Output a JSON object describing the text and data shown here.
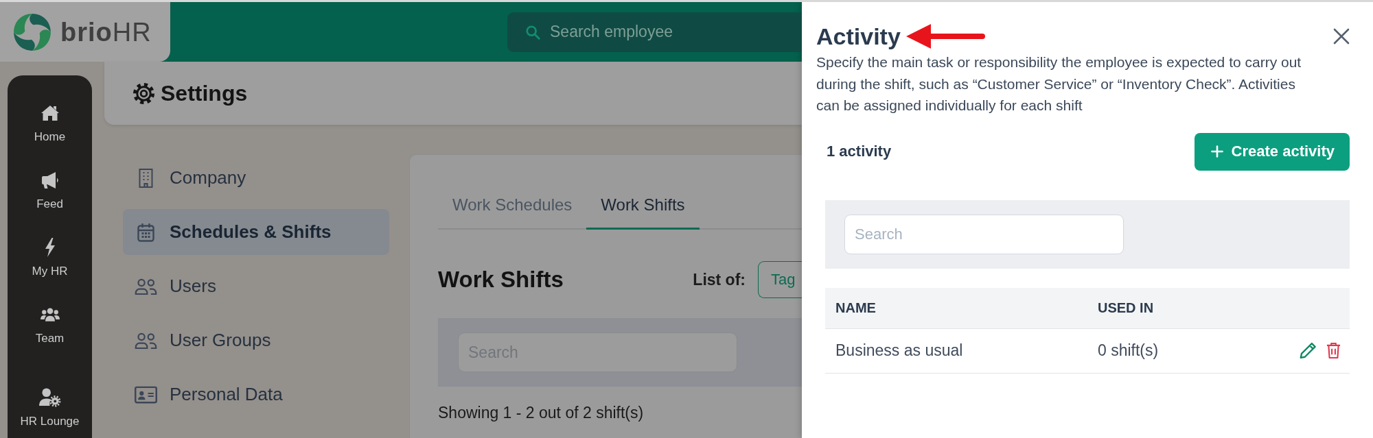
{
  "logo": {
    "text": "**brio**HR"
  },
  "header": {
    "search": {
      "placeholder": "Search employee"
    }
  },
  "sidebar": {
    "items": [
      {
        "label": "Home"
      },
      {
        "label": "Feed"
      },
      {
        "label": "My HR"
      },
      {
        "label": "Team"
      }
    ],
    "lower_items": [
      {
        "label": "HR Lounge"
      }
    ]
  },
  "page": {
    "title": "Settings"
  },
  "settings_nav": {
    "items": [
      {
        "label": "Company",
        "selected": false
      },
      {
        "label": "Schedules & Shifts",
        "selected": true
      },
      {
        "label": "Users",
        "selected": false
      },
      {
        "label": "User Groups",
        "selected": false
      },
      {
        "label": "Personal Data",
        "selected": false
      }
    ]
  },
  "content": {
    "tabs": [
      {
        "label": "Work Schedules",
        "selected": false
      },
      {
        "label": "Work Shifts",
        "selected": true
      }
    ],
    "title": "Work Shifts",
    "list_of": {
      "label": "List of:",
      "button": "Tag"
    },
    "search": {
      "placeholder": "Search"
    },
    "summary": "Showing 1 - 2 out of 2 shift(s)"
  },
  "panel": {
    "title": "Activity",
    "description": "Specify the main task or responsibility the employee is expected to carry out during the shift, such as “Customer Service” or “Inventory Check”. Activities can be assigned individually for each shift",
    "count": "1 activity",
    "create_button": "Create activity",
    "search": {
      "placeholder": "Search"
    },
    "table": {
      "columns": [
        "NAME",
        "USED IN"
      ],
      "rows": [
        {
          "name": "Business as usual",
          "used_in": "0 shift(s)"
        }
      ]
    }
  }
}
